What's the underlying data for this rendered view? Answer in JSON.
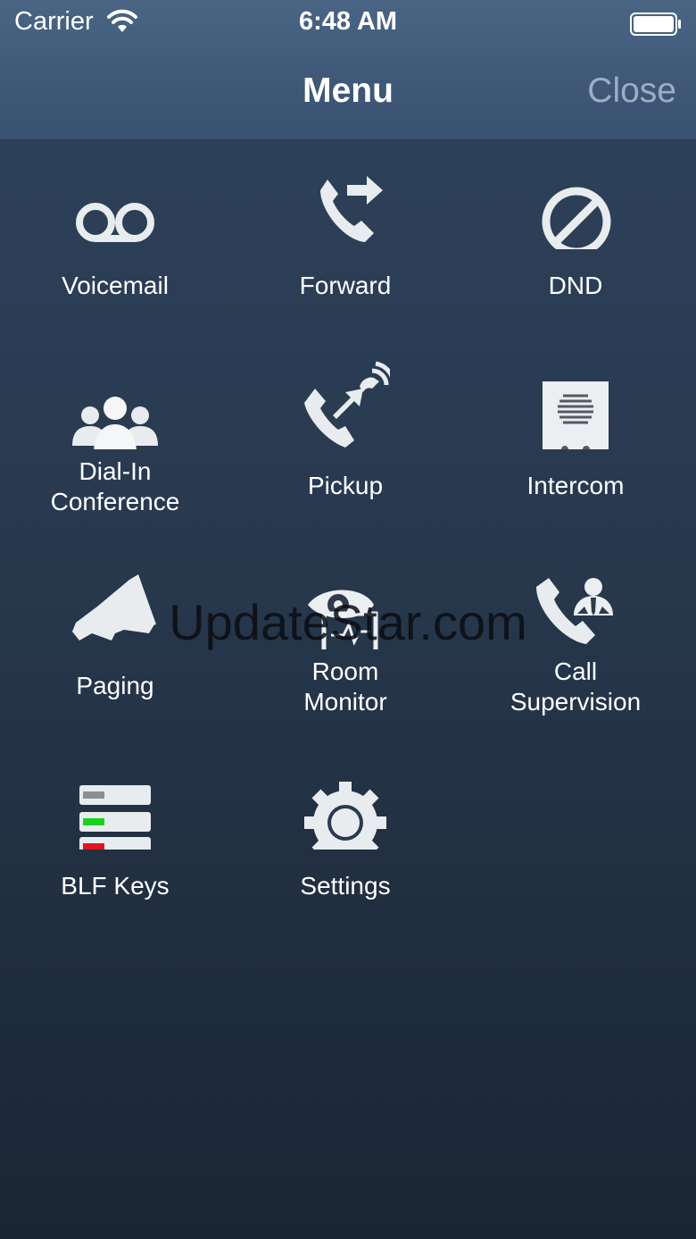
{
  "status_bar": {
    "carrier": "Carrier",
    "time": "6:48 AM"
  },
  "nav": {
    "title": "Menu",
    "close_label": "Close"
  },
  "menu_items": [
    {
      "id": "voicemail",
      "label_lines": [
        "Voicemail"
      ],
      "icon": "voicemail-icon"
    },
    {
      "id": "forward",
      "label_lines": [
        "Forward"
      ],
      "icon": "call-forward-icon"
    },
    {
      "id": "dnd",
      "label_lines": [
        "DND"
      ],
      "icon": "do-not-disturb-icon"
    },
    {
      "id": "dial-in-conference",
      "label_lines": [
        "Dial-In",
        "Conference"
      ],
      "icon": "conference-people-icon"
    },
    {
      "id": "pickup",
      "label_lines": [
        "Pickup"
      ],
      "icon": "call-pickup-icon"
    },
    {
      "id": "intercom",
      "label_lines": [
        "Intercom"
      ],
      "icon": "intercom-speaker-icon"
    },
    {
      "id": "paging",
      "label_lines": [
        "Paging"
      ],
      "icon": "megaphone-icon"
    },
    {
      "id": "room-monitor",
      "label_lines": [
        "Room",
        "Monitor"
      ],
      "icon": "eye-monitor-icon"
    },
    {
      "id": "call-supervision",
      "label_lines": [
        "Call",
        "Supervision"
      ],
      "icon": "call-supervisor-icon"
    },
    {
      "id": "blf-keys",
      "label_lines": [
        "BLF Keys"
      ],
      "icon": "blf-keys-icon"
    },
    {
      "id": "settings",
      "label_lines": [
        "Settings"
      ],
      "icon": "gear-icon"
    }
  ],
  "watermark": "UpdateStar.com",
  "colors": {
    "header": "#3f5877",
    "background": "#293a50",
    "close": "#9aaec4",
    "blf_green": "#19d21e",
    "blf_red": "#e0141a",
    "blf_gray": "#8a8f96"
  }
}
